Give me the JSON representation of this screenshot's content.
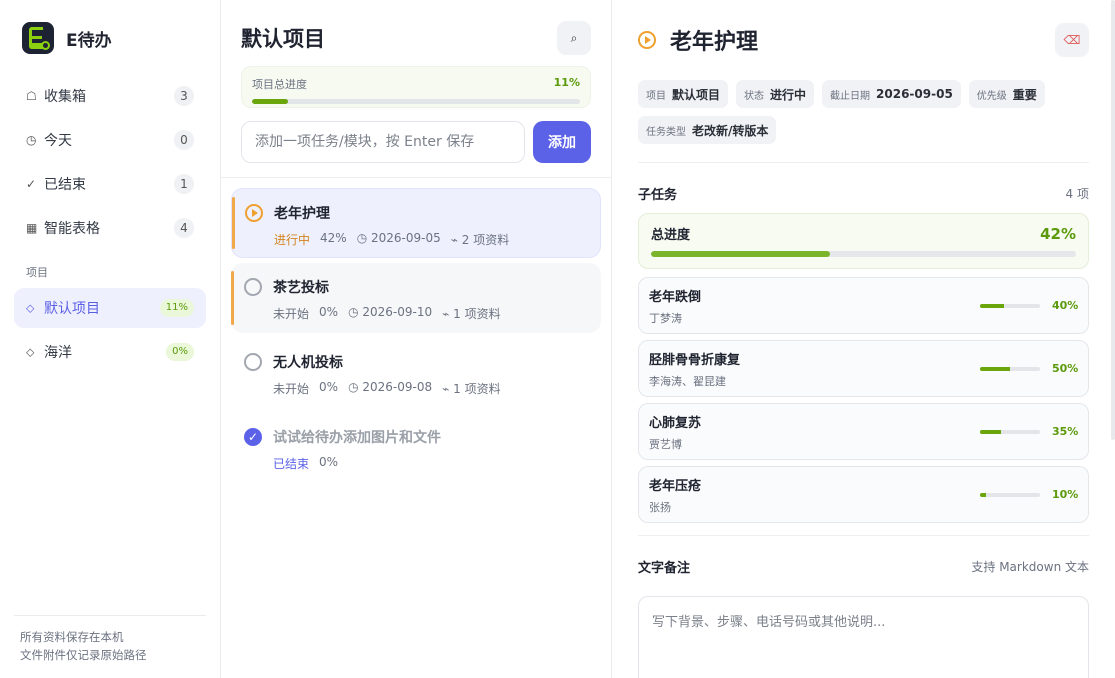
{
  "app": {
    "name": "E待办"
  },
  "sidebar": {
    "items": [
      {
        "icon": "☖",
        "label": "收集箱",
        "count": "3"
      },
      {
        "icon": "◷",
        "label": "今天",
        "count": "0"
      },
      {
        "icon": "✓",
        "label": "已结束",
        "count": "1"
      },
      {
        "icon": "▦",
        "label": "智能表格",
        "count": "4"
      }
    ],
    "section_label": "项目",
    "projects": [
      {
        "icon": "⬦",
        "label": "默认项目",
        "pct": "11%"
      },
      {
        "icon": "⬦",
        "label": "海洋",
        "pct": "0%"
      }
    ],
    "footer": [
      "所有资料保存在本机",
      "文件附件仅记录原始路径"
    ]
  },
  "middle": {
    "title": "默认项目",
    "search_icon": "⌕",
    "progress": {
      "label": "项目总进度",
      "pct": "11%",
      "value": 0.11
    },
    "add": {
      "placeholder": "添加一项任务/模块，按 Enter 保存",
      "button": "添加"
    },
    "tasks": [
      {
        "title": "老年护理",
        "status": "进行中",
        "pct": "42%",
        "date": "◷ 2026-09-05",
        "files": "⌁ 2 项资料"
      },
      {
        "title": "茶艺投标",
        "status": "未开始",
        "pct": "0%",
        "date": "◷ 2026-09-10",
        "files": "⌁ 1 项资料"
      },
      {
        "title": "无人机投标",
        "status": "未开始",
        "pct": "0%",
        "date": "◷ 2026-09-08",
        "files": "⌁ 1 项资料"
      },
      {
        "title": "试试给待办添加图片和文件",
        "status": "已结束",
        "pct": "0%"
      }
    ]
  },
  "detail": {
    "title": "老年护理",
    "delete_icon": "⌫",
    "chips": [
      {
        "k": "项目",
        "v": "默认项目"
      },
      {
        "k": "状态",
        "v": "进行中"
      },
      {
        "k": "截止日期",
        "v": "2026-09-05"
      },
      {
        "k": "优先级",
        "v": "重要"
      },
      {
        "k": "任务类型",
        "v": "老改新/转版本"
      }
    ],
    "subtasks_label": "子任务",
    "subtasks_count": "4 项",
    "total": {
      "label": "总进度",
      "pct": "42%",
      "value": 0.42
    },
    "subtasks": [
      {
        "name": "老年跌倒",
        "owner": "丁梦涛",
        "pct": "40%",
        "value": 0.4
      },
      {
        "name": "胫腓骨骨折康复",
        "owner": "李海涛、翟昆建",
        "pct": "50%",
        "value": 0.5
      },
      {
        "name": "心肺复苏",
        "owner": "贾艺博",
        "pct": "35%",
        "value": 0.35
      },
      {
        "name": "老年压疮",
        "owner": "张扬",
        "pct": "10%",
        "value": 0.1
      }
    ],
    "notes": {
      "label": "文字备注",
      "hint": "支持 Markdown 文本",
      "placeholder": "写下背景、步骤、电话号码或其他说明..."
    }
  }
}
